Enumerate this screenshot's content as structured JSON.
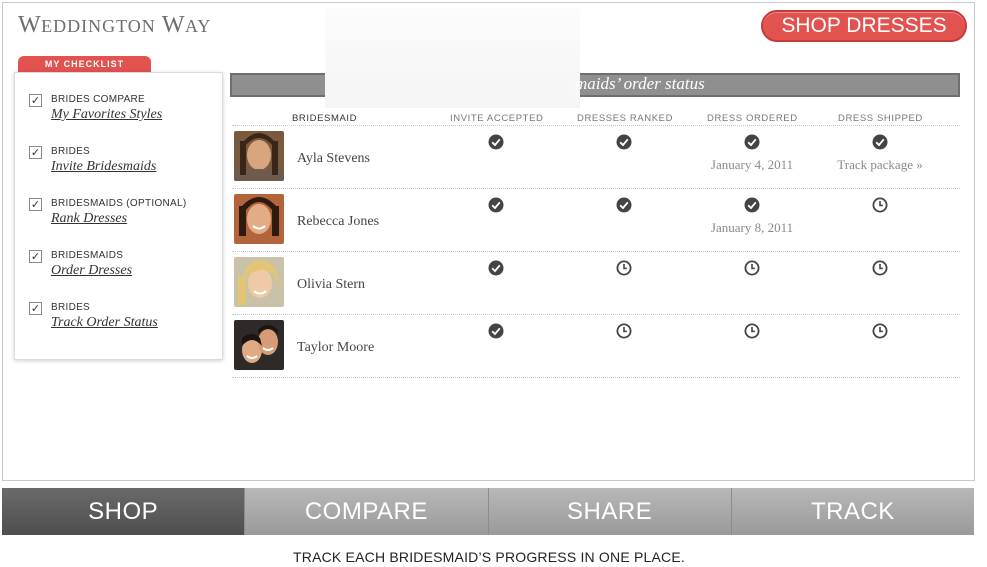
{
  "header": {
    "logo_text_1": "W",
    "logo_text_2": "EDDINGTON",
    "logo_text_3": " W",
    "logo_text_4": "AY",
    "shop_button": "SHOP DRESSES"
  },
  "checklist": {
    "tab_label": "MY CHECKLIST",
    "items": [
      {
        "role": "BRIDES COMPARE",
        "link": "My Favorites Styles",
        "checked": true
      },
      {
        "role": "BRIDES",
        "link": "Invite Bridesmaids",
        "checked": true
      },
      {
        "role": "BRIDESMAIDS (OPTIONAL)",
        "link": "Rank Dresses",
        "checked": true
      },
      {
        "role": "BRIDESMAIDS",
        "link": "Order Dresses",
        "checked": true
      },
      {
        "role": "BRIDES",
        "link": "Track Order Status",
        "checked": true
      }
    ],
    "check_glyph": "✓"
  },
  "status": {
    "title": "maids’ order status",
    "columns": [
      "BRIDESMAID",
      "INVITE ACCEPTED",
      "DRESSES RANKED",
      "DRESS ORDERED",
      "DRESS SHIPPED"
    ],
    "rows": [
      {
        "name": "Ayla Stevens",
        "invite": "check-icon",
        "ranked": "check-icon",
        "ordered": "check-icon",
        "ordered_text": "January 4, 2011",
        "shipped": "check-icon",
        "shipped_text": "Track package »"
      },
      {
        "name": "Rebecca Jones",
        "invite": "check-icon",
        "ranked": "check-icon",
        "ordered": "check-icon",
        "ordered_text": "January 8, 2011",
        "shipped": "clock-icon",
        "shipped_text": ""
      },
      {
        "name": "Olivia Stern",
        "invite": "check-icon",
        "ranked": "clock-icon",
        "ordered": "clock-icon",
        "ordered_text": "",
        "shipped": "clock-icon",
        "shipped_text": ""
      },
      {
        "name": "Taylor Moore",
        "invite": "check-icon",
        "ranked": "clock-icon",
        "ordered": "clock-icon",
        "ordered_text": "",
        "shipped": "clock-icon",
        "shipped_text": ""
      }
    ]
  },
  "nav": {
    "tabs": [
      {
        "label": "SHOP",
        "active": true
      },
      {
        "label": "COMPARE",
        "active": false
      },
      {
        "label": "SHARE",
        "active": false
      },
      {
        "label": "TRACK",
        "active": false
      }
    ]
  },
  "caption": "TRACK EACH BRIDESMAID’S PROGRESS IN ONE PLACE.",
  "colors": {
    "accent": "#e2524f",
    "nav_active": "#575757",
    "nav_inactive": "#a8a8a8",
    "status_bar": "#8f8f8f"
  }
}
